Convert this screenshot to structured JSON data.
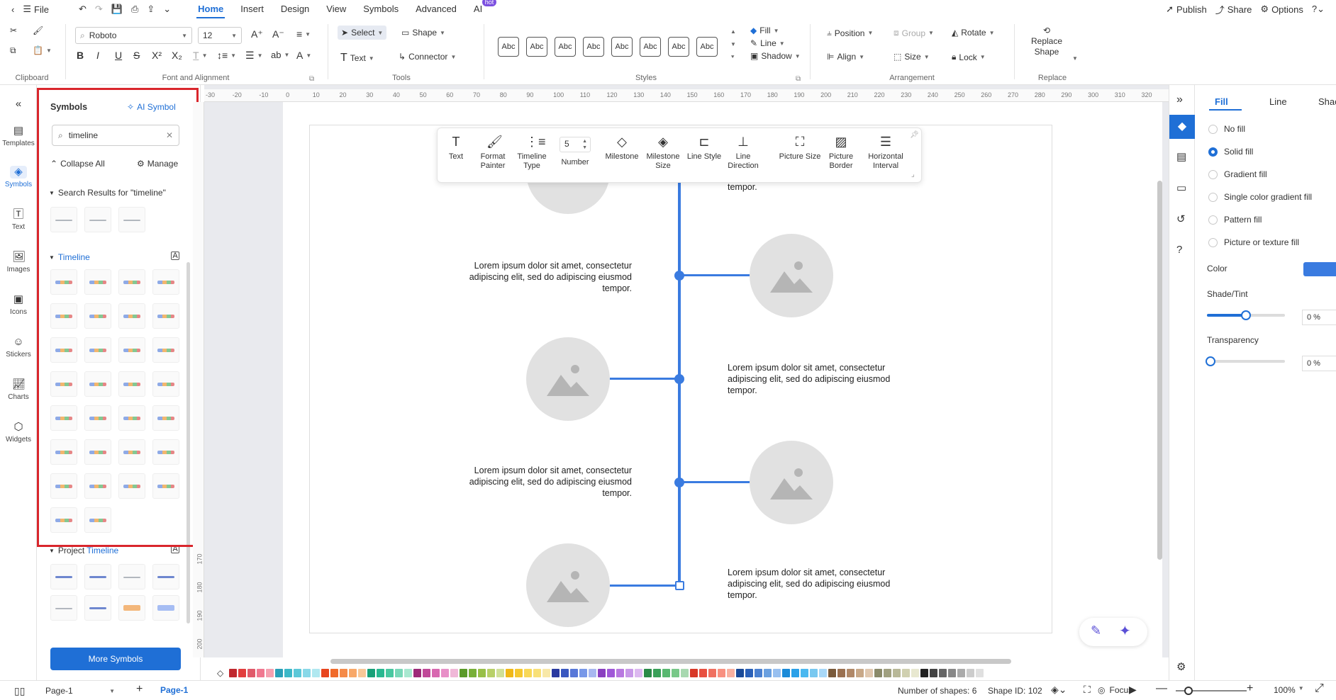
{
  "menubar": {
    "file": "File",
    "tabs": [
      "Home",
      "Insert",
      "Design",
      "View",
      "Symbols",
      "Advanced",
      "AI"
    ],
    "ai_badge": "hot",
    "publish": "Publish",
    "share": "Share",
    "options": "Options"
  },
  "ribbon": {
    "font_name": "Roboto",
    "font_size": "12",
    "groups": {
      "clipboard": "Clipboard",
      "font": "Font and Alignment",
      "tools": "Tools",
      "styles": "Styles",
      "arrangement": "Arrangement",
      "replace": "Replace"
    },
    "select": "Select",
    "shape": "Shape",
    "text": "Text",
    "connector": "Connector",
    "style_sample": "Abc",
    "fill": "Fill",
    "line": "Line",
    "shadow": "Shadow",
    "position": "Position",
    "group": "Group",
    "rotate": "Rotate",
    "align": "Align",
    "size": "Size",
    "lock": "Lock",
    "replace_shape_1": "Replace",
    "replace_shape_2": "Shape"
  },
  "leftnav": [
    "Templates",
    "Symbols",
    "Text",
    "Images",
    "Icons",
    "Stickers",
    "Charts",
    "Widgets"
  ],
  "symbols": {
    "title": "Symbols",
    "ai_symbol": "AI Symbol",
    "search_value": "timeline",
    "collapse_all": "Collapse All",
    "manage": "Manage",
    "search_results": "Search Results for  \"timeline\"",
    "timeline_section": "Timeline",
    "project_prefix": "Project",
    "project_word": "Timeline",
    "more_symbols": "More Symbols"
  },
  "hruler_ticks": [
    "-30",
    "-20",
    "-10",
    "0",
    "10",
    "20",
    "30",
    "40",
    "50",
    "60",
    "70",
    "80",
    "90",
    "100",
    "110",
    "120",
    "130",
    "140",
    "150",
    "160",
    "170",
    "180",
    "190",
    "200",
    "210",
    "220",
    "230",
    "240",
    "250",
    "260",
    "270",
    "280",
    "290",
    "300",
    "310",
    "320"
  ],
  "vruler_ticks": [
    "170",
    "180",
    "190",
    "200"
  ],
  "contextbar": {
    "items": [
      "Text",
      "Format Painter",
      "Timeline Type",
      "Number",
      "Milestone",
      "Milestone Size",
      "Line Style",
      "Line Direction",
      "Picture Size",
      "Picture Border",
      "Horizontal Interval"
    ],
    "number_value": "5"
  },
  "timeline": {
    "lorem": "Lorem ipsum dolor sit amet, consectetur adipiscing elit, sed do adipiscing eiusmod tempor.",
    "lorem_top_tail": "tempor.",
    "accent_color": "#3a7be0"
  },
  "rightpanel": {
    "tabs": [
      "Fill",
      "Line",
      "Shac"
    ],
    "fill_options": [
      "No fill",
      "Solid fill",
      "Gradient fill",
      "Single color gradient fill",
      "Pattern fill",
      "Picture or texture fill"
    ],
    "selected_fill": "Solid fill",
    "color_label": "Color",
    "color_value": "#3a7be0",
    "shade_label": "Shade/Tint",
    "shade_value": "0 %",
    "shade_level": 0.5,
    "transparency_label": "Transparency",
    "transparency_value": "0 %",
    "transparency_level": 0
  },
  "statusbar": {
    "page_select": "Page-1",
    "page_tab": "Page-1",
    "shapes": "Number of shapes: 6",
    "shape_id": "Shape ID: 102",
    "focus": "Focus",
    "zoom": "100%"
  }
}
